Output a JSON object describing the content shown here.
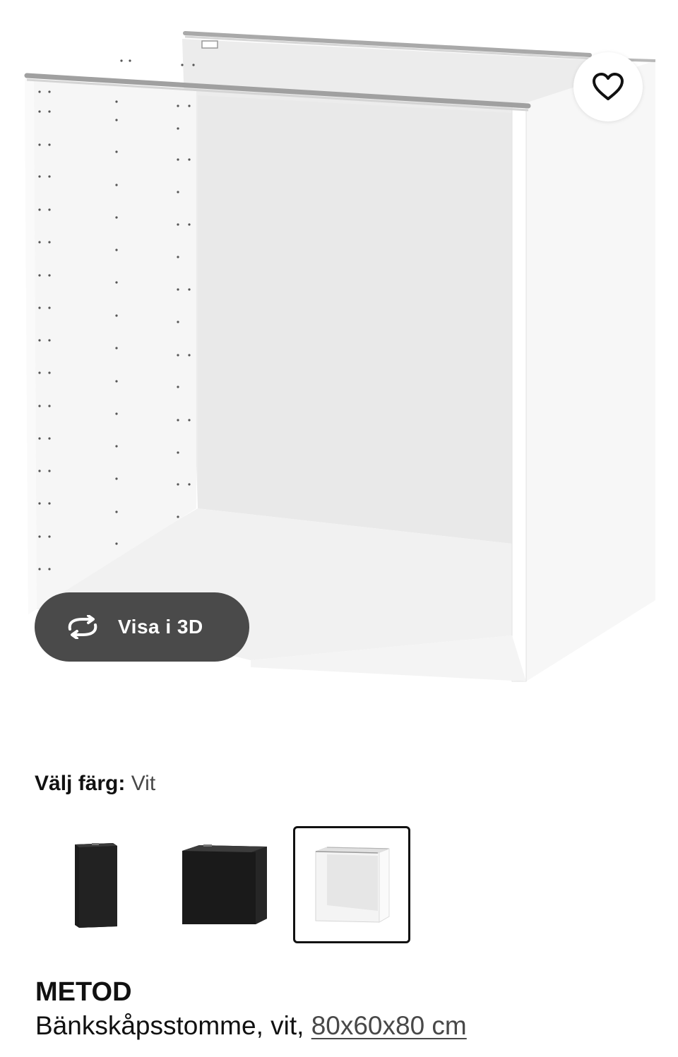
{
  "hero": {
    "image_alt": "METOD Bänkskåpsstomme, vit",
    "favorite_icon": "heart-outline-icon",
    "view3d": {
      "icon": "rotate-arrows-icon",
      "label": "Visa i 3D"
    }
  },
  "color_picker": {
    "label": "Välj färg:",
    "selected_value": "Vit",
    "options": [
      {
        "name": "Svart narrow",
        "color": "#1f1f1f"
      },
      {
        "name": "Svart wide",
        "color": "#1f1f1f"
      },
      {
        "name": "Vit",
        "color": "#ffffff"
      }
    ],
    "selected_border_color": "#111111"
  },
  "product": {
    "name": "METOD",
    "description_prefix": "Bänkskåpsstomme, vit,",
    "size_link": "80x60x80 cm"
  },
  "colors": {
    "button_dark": "#4a4a4a",
    "text_primary": "#111111",
    "text_secondary": "#484848"
  }
}
